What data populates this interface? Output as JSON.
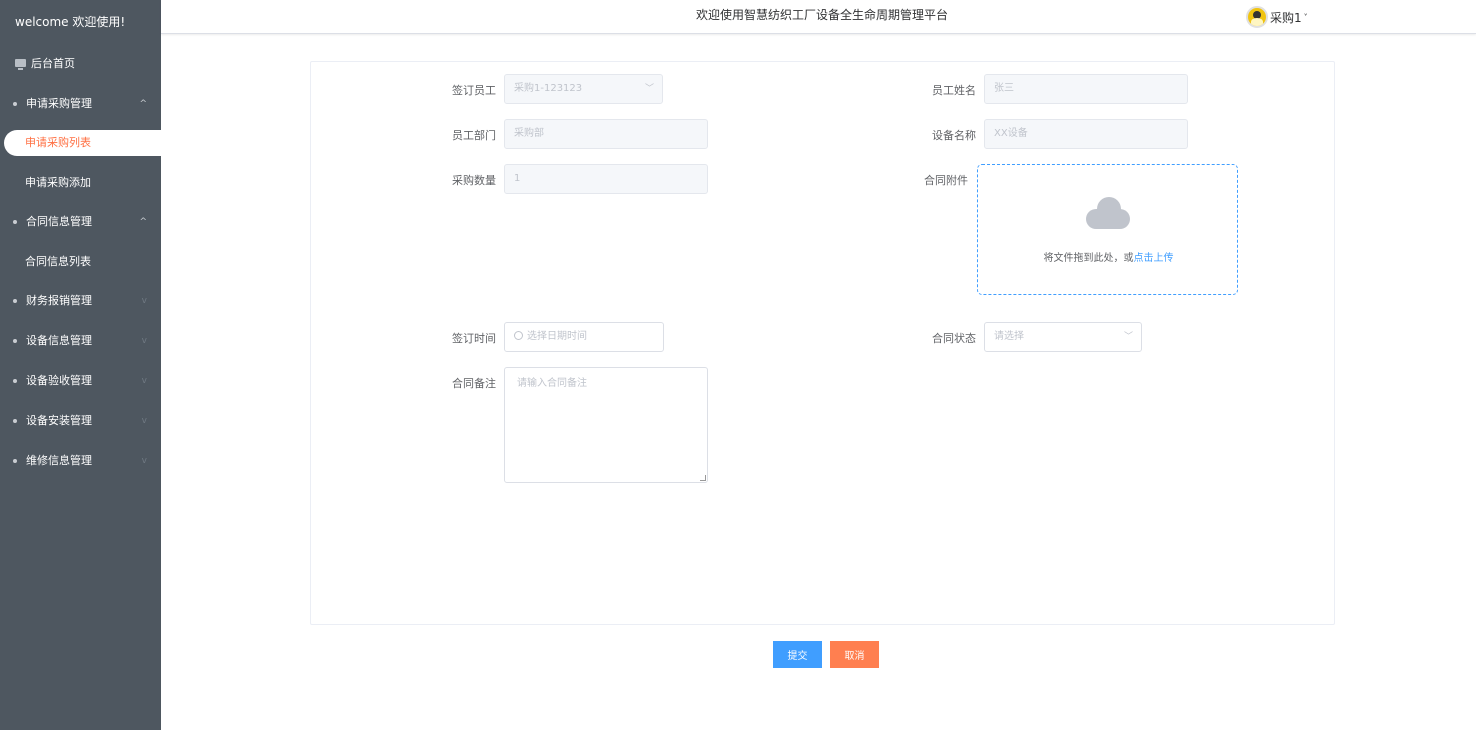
{
  "sidebar": {
    "welcome": "welcome 欢迎使用!",
    "home": "后台首页",
    "menu": [
      {
        "label": "申请采购管理",
        "expanded": true
      },
      {
        "label": "合同信息管理",
        "expanded": true
      },
      {
        "label": "财务报销管理",
        "expanded": false
      },
      {
        "label": "设备信息管理",
        "expanded": false
      },
      {
        "label": "设备验收管理",
        "expanded": false
      },
      {
        "label": "设备安装管理",
        "expanded": false
      },
      {
        "label": "维修信息管理",
        "expanded": false
      }
    ],
    "purchase_sub": [
      "申请采购列表",
      "申请采购添加"
    ],
    "contract_sub": [
      "合同信息列表"
    ],
    "arrow_up": "^",
    "arrow_down": "v"
  },
  "header": {
    "title": "欢迎使用智慧纺织工厂设备全生命周期管理平台",
    "user": "采购1",
    "caret": "˅"
  },
  "form": {
    "sign_staff": {
      "label": "签订员工",
      "value": "采购1-123123"
    },
    "staff_name": {
      "label": "员工姓名",
      "value": "张三"
    },
    "staff_dept": {
      "label": "员工部门",
      "value": "采购部"
    },
    "device_name": {
      "label": "设备名称",
      "value": "XX设备"
    },
    "quantity": {
      "label": "采购数量",
      "value": "1"
    },
    "attachment": {
      "label": "合同附件",
      "hint": "将文件拖到此处，或",
      "link": "点击上传"
    },
    "sign_time": {
      "label": "签订时间",
      "placeholder": "选择日期时间"
    },
    "status": {
      "label": "合同状态",
      "placeholder": "请选择"
    },
    "remark": {
      "label": "合同备注",
      "placeholder": "请输入合同备注"
    }
  },
  "buttons": {
    "submit": "提交",
    "cancel": "取消"
  },
  "colors": {
    "sidebar_bg": "#4e5760",
    "accent": "#409eff",
    "active": "#ff7043",
    "cancel": "#ff7f50"
  }
}
